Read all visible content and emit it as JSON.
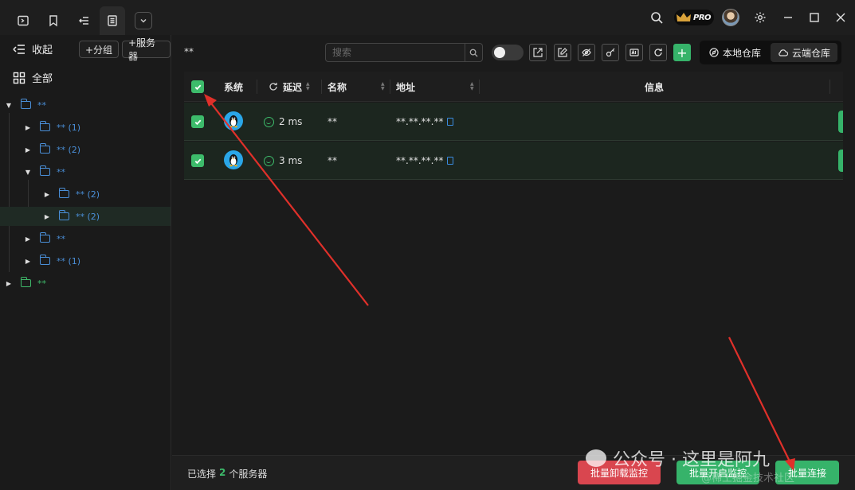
{
  "titlebar": {
    "tabs": [
      {
        "icon": "terminal-icon"
      },
      {
        "icon": "bookmark-icon"
      },
      {
        "icon": "transfer-icon"
      },
      {
        "icon": "server-list-icon",
        "active": true
      }
    ],
    "dropdown_icon": "chevron-down-icon",
    "pro_label": "PRO"
  },
  "sidebar": {
    "collapse_label": "收起",
    "add_group_label": "+分组",
    "add_server_label": "+服务器",
    "all_label": "全部",
    "tree": [
      {
        "label": "**",
        "expanded": true
      },
      {
        "label": "** (1)"
      },
      {
        "label": "** (2)"
      },
      {
        "label": "**",
        "expanded": true
      },
      {
        "label": "** (2)"
      },
      {
        "label": "** (2)",
        "selected": true
      },
      {
        "label": "**"
      },
      {
        "label": "** (1)"
      },
      {
        "label": "**",
        "color": "#3fb86a"
      }
    ]
  },
  "main": {
    "breadcrumb": "**",
    "search_placeholder": "搜索",
    "repo_tabs": [
      "本地仓库",
      "云端仓库"
    ],
    "columns": [
      "系统",
      "延迟",
      "名称",
      "地址",
      "信息"
    ],
    "rows": [
      {
        "latency": "2 ms",
        "name": "**",
        "address": "**.**.**.**"
      },
      {
        "latency": "3 ms",
        "name": "**",
        "address": "**.**.**.**"
      }
    ],
    "footer": {
      "prefix": "已选择",
      "count": "2",
      "suffix": "个服务器",
      "uninstall_label": "批量卸载监控",
      "start_label": "批量开启监控",
      "connect_label": "批量连接"
    }
  },
  "watermark": {
    "text": "公众号 · 这里是阿九",
    "sub": "@稀土掘金技术社区"
  },
  "colors": {
    "accent_green": "#36b36a",
    "danger_red": "#d9464f",
    "folder_blue": "#4a8fd8",
    "annotation_arrow": "#e0302a"
  }
}
